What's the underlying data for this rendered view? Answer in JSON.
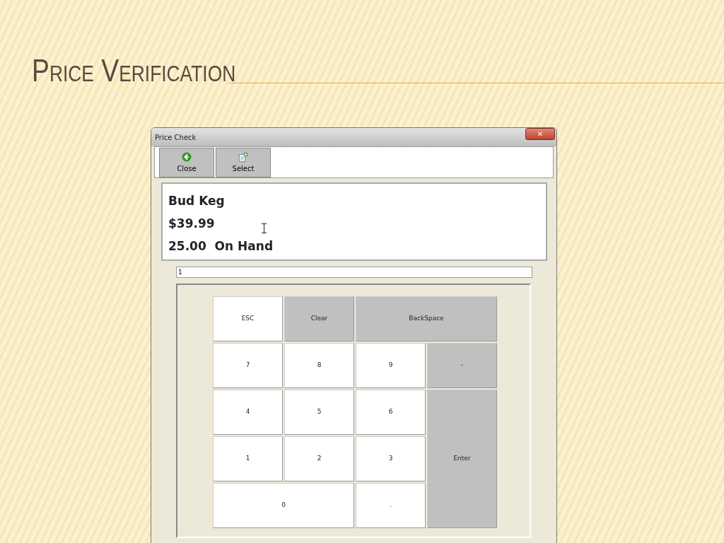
{
  "slide_title": "Price Verification",
  "window": {
    "title": "Price Check",
    "close_glyph": "✕"
  },
  "toolbar": [
    {
      "label": "Close",
      "kind": "back"
    },
    {
      "label": "Select",
      "kind": "select"
    }
  ],
  "item": {
    "name": "Bud Keg",
    "price": "$39.99",
    "quantity": "25.00",
    "quantity_label": "On Hand"
  },
  "entry": {
    "value": "1"
  },
  "keypad": [
    {
      "label": "ESC",
      "kind": "light",
      "wide": false,
      "tall": false
    },
    {
      "label": "Clear",
      "kind": "dark",
      "wide": false,
      "tall": false
    },
    {
      "label": "BackSpace",
      "kind": "dark",
      "wide": true,
      "tall": false
    },
    {
      "label": "7",
      "kind": "light",
      "wide": false,
      "tall": false
    },
    {
      "label": "8",
      "kind": "light",
      "wide": false,
      "tall": false
    },
    {
      "label": "9",
      "kind": "light",
      "wide": false,
      "tall": false
    },
    {
      "label": "-",
      "kind": "dark",
      "wide": false,
      "tall": false
    },
    {
      "label": "4",
      "kind": "light",
      "wide": false,
      "tall": false
    },
    {
      "label": "5",
      "kind": "light",
      "wide": false,
      "tall": false
    },
    {
      "label": "6",
      "kind": "light",
      "wide": false,
      "tall": false
    },
    {
      "label": "1",
      "kind": "light",
      "wide": false,
      "tall": false
    },
    {
      "label": "2",
      "kind": "light",
      "wide": false,
      "tall": false
    },
    {
      "label": "3",
      "kind": "light",
      "wide": false,
      "tall": false
    },
    {
      "label": "Enter",
      "kind": "dark",
      "wide": false,
      "tall": true
    },
    {
      "label": "0",
      "kind": "light",
      "wide": true,
      "tall": false
    },
    {
      "label": ".",
      "kind": "light",
      "wide": false,
      "tall": false
    }
  ]
}
